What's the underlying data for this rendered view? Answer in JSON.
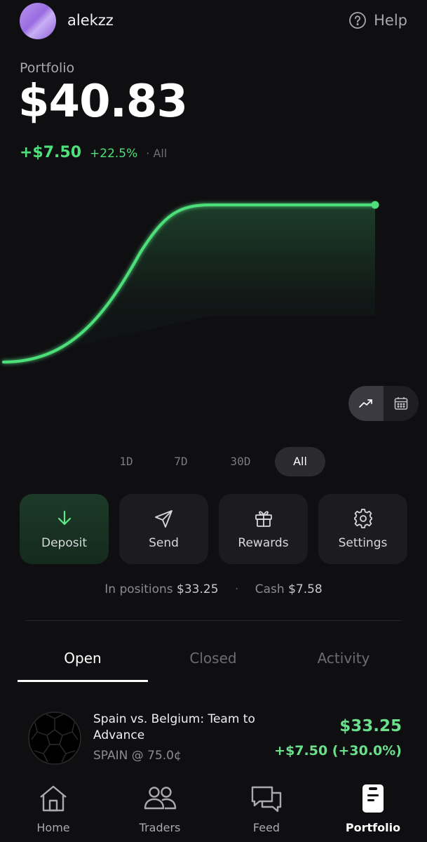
{
  "header": {
    "username": "alekzz",
    "help_label": "Help"
  },
  "portfolio": {
    "label": "Portfolio",
    "balance": "$40.83",
    "gain_abs": "+$7.50",
    "gain_pct": "+22.5%",
    "gain_range": "· All"
  },
  "colors": {
    "accent_green": "#4ee07a",
    "background": "#0f0f12"
  },
  "ranges": [
    "1D",
    "7D",
    "30D",
    "All"
  ],
  "selected_range": "All",
  "actions": [
    {
      "label": "Deposit",
      "icon": "arrow-down-icon"
    },
    {
      "label": "Send",
      "icon": "send-icon"
    },
    {
      "label": "Rewards",
      "icon": "gift-icon"
    },
    {
      "label": "Settings",
      "icon": "gear-icon"
    }
  ],
  "summary": {
    "positions_label": "In positions",
    "positions_value": "$33.25",
    "cash_label": "Cash",
    "cash_value": "$7.58"
  },
  "tabs": [
    "Open",
    "Closed",
    "Activity"
  ],
  "selected_tab": "Open",
  "positions": [
    {
      "title": "Spain vs. Belgium: Team to Advance",
      "subtitle": "SPAIN @ 75.0¢",
      "value": "$33.25",
      "pnl": "+$7.50 (+30.0%)",
      "icon": "soccer-ball-icon"
    }
  ],
  "bottom_nav": [
    {
      "label": "Home",
      "icon": "home-icon"
    },
    {
      "label": "Traders",
      "icon": "users-icon"
    },
    {
      "label": "Feed",
      "icon": "chat-icon"
    },
    {
      "label": "Portfolio",
      "icon": "clipboard-icon"
    }
  ],
  "active_nav": "Portfolio"
}
